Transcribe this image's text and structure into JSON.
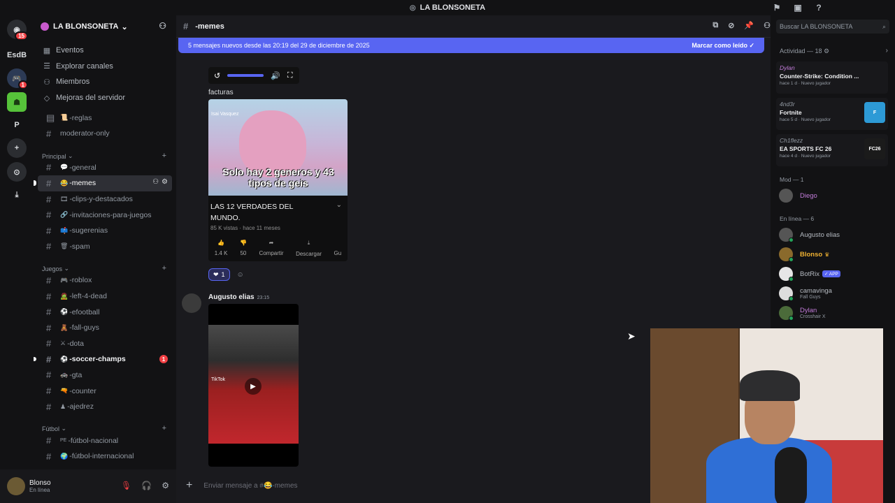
{
  "titlebar": {
    "server_name": "LA BLONSONETA"
  },
  "guilds": [
    {
      "label": "EsdB"
    },
    {
      "label": "P"
    }
  ],
  "guild_badges": {
    "home": "15",
    "second": "1"
  },
  "sidebar": {
    "server_name": "LA BLONSONETA",
    "nav": [
      "Eventos",
      "Explorar canales",
      "Miembros",
      "Mejoras del servidor"
    ],
    "top_channels": [
      {
        "emoji": "📜",
        "name": "-reglas"
      },
      {
        "emoji": "",
        "name": "moderator-only"
      }
    ],
    "categories": [
      {
        "name": "Principal",
        "channels": [
          {
            "emoji": "💬",
            "name": "-general"
          },
          {
            "emoji": "😂",
            "name": "-memes"
          },
          {
            "emoji": "🎞",
            "name": "-clips-y-destacados"
          },
          {
            "emoji": "🔗",
            "name": "-invitaciones-para-juegos"
          },
          {
            "emoji": "📫",
            "name": "-sugerenias"
          },
          {
            "emoji": "🗑",
            "name": "-spam"
          }
        ]
      },
      {
        "name": "Juegos",
        "channels": [
          {
            "emoji": "🎮",
            "name": "-roblox"
          },
          {
            "emoji": "🧟",
            "name": "-left-4-dead"
          },
          {
            "emoji": "⚽",
            "name": "-efootball"
          },
          {
            "emoji": "🧸",
            "name": "-fall-guys"
          },
          {
            "emoji": "⚔",
            "name": "-dota"
          },
          {
            "emoji": "⚽",
            "name": "-soccer-champs",
            "unread": "1"
          },
          {
            "emoji": "🚓",
            "name": "-gta"
          },
          {
            "emoji": "🔫",
            "name": "-counter"
          },
          {
            "emoji": "♟",
            "name": "-ajedrez"
          }
        ]
      },
      {
        "name": "Fútbol",
        "channels": [
          {
            "emoji": "PE",
            "name": "-fútbol-nacional"
          },
          {
            "emoji": "🌍",
            "name": "-fútbol-internacional"
          }
        ]
      }
    ]
  },
  "user": {
    "name": "Blonso",
    "status": "En línea"
  },
  "channel": {
    "name": "-memes",
    "new_messages_banner": "5 mensajes nuevos desde las 20:19 del 29 de diciembre de 2025",
    "mark_read": "Marcar como leído"
  },
  "messages": {
    "prev_caption": "facturas",
    "youtube": {
      "channel_tag": "Isai Vasquez",
      "thumb_text": "Solo hay 2 generos y 43 tipos de geis",
      "title": "LAS 12 VERDADES DEL MUNDO.",
      "meta": "85 K vistas · hace 11 meses",
      "likes": "1.4 K",
      "dislikes": "50",
      "share": "Compartir",
      "download": "Descargar",
      "more": "Gu"
    },
    "reaction_count": "1",
    "author": "Augusto elias",
    "time": "23:15",
    "video_tag": "TikTok"
  },
  "composer": {
    "placeholder": "Enviar mensaje a #😂-memes"
  },
  "right_panel": {
    "search_placeholder": "Buscar LA BLONSONETA",
    "activity_header": "Actividad — 18",
    "activities": [
      {
        "user": "Dylan",
        "game": "Counter-Strike: Condition ...",
        "time": "hace 1 d",
        "tag": "Nuevo jugador",
        "art": ""
      },
      {
        "user": "4nd3r",
        "game": "Fortnite",
        "time": "hace 5 d",
        "tag": "Nuevo jugador",
        "art": "F"
      },
      {
        "user": "Ch1flezz",
        "game": "EA SPORTS FC 26",
        "time": "hace 4 d",
        "tag": "Nuevo jugador",
        "art": "FC26"
      }
    ],
    "mod_header": "Mod — 1",
    "mods": [
      {
        "name": "Diego"
      }
    ],
    "online_header": "En línea — 6",
    "online": [
      {
        "name": "Augusto elias",
        "sub": ""
      },
      {
        "name": "Blonso",
        "sub": ""
      },
      {
        "name": "BotRix",
        "sub": "",
        "app": "✓ APP"
      },
      {
        "name": "camavinga",
        "sub": "Fall Guys"
      },
      {
        "name": "Dylan",
        "sub": "Crosshair X"
      }
    ]
  },
  "colors": {
    "accent": "#5865f2",
    "danger": "#f23f43",
    "online": "#23a55a",
    "nitro": "#c27cd9"
  }
}
